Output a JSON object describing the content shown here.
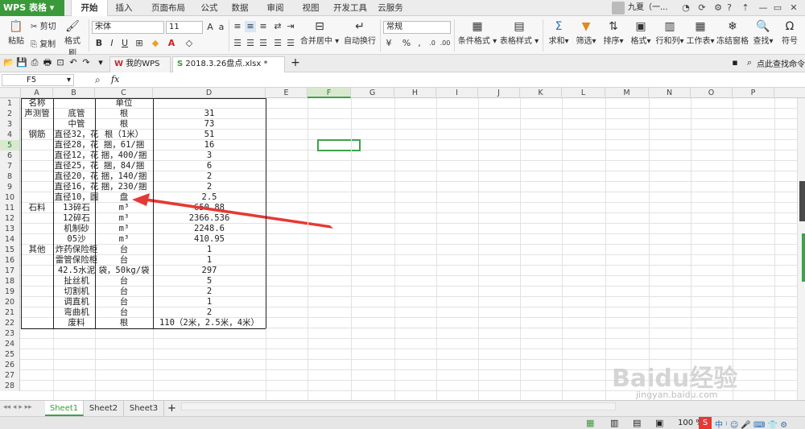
{
  "app": {
    "name": "WPS 表格",
    "accent": "#3a9a3a"
  },
  "menu": {
    "tabs": [
      "开始",
      "插入",
      "页面布局",
      "公式",
      "数据",
      "审阅",
      "视图",
      "开发工具",
      "云服务"
    ],
    "active": "开始",
    "user": "九夏（一..."
  },
  "ribbon": {
    "paste": "粘贴",
    "cut": "剪切",
    "copy": "复制",
    "format_painter": "格式刷",
    "font_name": "宋体",
    "font_size": "11",
    "merge_center": "合并居中",
    "wrap_text": "自动换行",
    "number_format": "常规",
    "cond_format": "条件格式",
    "table_style": "表格样式",
    "sum": "求和",
    "filter": "筛选",
    "sort": "排序",
    "format": "格式",
    "row_col": "行和列",
    "worksheet": "工作表",
    "freeze": "冻结窗格",
    "find": "查找",
    "symbol": "符号"
  },
  "tabs": {
    "home": "我的WPS",
    "file": "2018.3.26盘点.xlsx *",
    "search": "点此查找命令"
  },
  "formula_bar": {
    "cell_ref": "F5",
    "fx": "fx",
    "value": ""
  },
  "columns": [
    "A",
    "B",
    "C",
    "D",
    "E",
    "F",
    "G",
    "H",
    "I",
    "J",
    "K",
    "L",
    "M",
    "N",
    "O",
    "P"
  ],
  "selected_column": "F",
  "selected_row": "5",
  "rows": [
    {
      "n": "1",
      "a": "名称",
      "b": "",
      "c": "单位",
      "d": ""
    },
    {
      "n": "2",
      "a": "声测管",
      "b": "底管",
      "c": "根",
      "d": "31"
    },
    {
      "n": "3",
      "a": "",
      "b": "中管",
      "c": "根",
      "d": "73"
    },
    {
      "n": "4",
      "a": "钢筋",
      "b": "直径32，花",
      "c": "根（1米）",
      "d": "51"
    },
    {
      "n": "5",
      "a": "",
      "b": "直径28，花",
      "c": "捆，61/捆",
      "d": "16"
    },
    {
      "n": "6",
      "a": "",
      "b": "直径12，花",
      "c": "捆，400/捆",
      "d": "3"
    },
    {
      "n": "7",
      "a": "",
      "b": "直径25，花",
      "c": "捆，84/捆",
      "d": "6"
    },
    {
      "n": "8",
      "a": "",
      "b": "直径20，花",
      "c": "捆，140/捆",
      "d": "2"
    },
    {
      "n": "9",
      "a": "",
      "b": "直径16，花",
      "c": "捆，230/捆",
      "d": "2"
    },
    {
      "n": "10",
      "a": "",
      "b": "直径10，圆",
      "c": "盘",
      "d": "2.5"
    },
    {
      "n": "11",
      "a": "石料",
      "b": "13碎石",
      "c": "m³",
      "d": "650.88"
    },
    {
      "n": "12",
      "a": "",
      "b": "12碎石",
      "c": "m³",
      "d": "2366.536"
    },
    {
      "n": "13",
      "a": "",
      "b": "机制砂",
      "c": "m³",
      "d": "2248.6"
    },
    {
      "n": "14",
      "a": "",
      "b": "05沙",
      "c": "m³",
      "d": "410.95"
    },
    {
      "n": "15",
      "a": "其他",
      "b": "炸药保险柜",
      "c": "台",
      "d": "1"
    },
    {
      "n": "16",
      "a": "",
      "b": "雷管保险柜",
      "c": "台",
      "d": "1"
    },
    {
      "n": "17",
      "a": "",
      "b": "42.5水泥",
      "c": "袋，50kg/袋",
      "d": "297"
    },
    {
      "n": "18",
      "a": "",
      "b": "扯丝机",
      "c": "台",
      "d": "5"
    },
    {
      "n": "19",
      "a": "",
      "b": "切割机",
      "c": "台",
      "d": "2"
    },
    {
      "n": "20",
      "a": "",
      "b": "调直机",
      "c": "台",
      "d": "1"
    },
    {
      "n": "21",
      "a": "",
      "b": "弯曲机",
      "c": "台",
      "d": "2"
    },
    {
      "n": "22",
      "a": "",
      "b": "废料",
      "c": "根",
      "d": "110（2米，2.5米，4米）"
    },
    {
      "n": "23",
      "a": "",
      "b": "",
      "c": "",
      "d": ""
    },
    {
      "n": "24",
      "a": "",
      "b": "",
      "c": "",
      "d": ""
    },
    {
      "n": "25",
      "a": "",
      "b": "",
      "c": "",
      "d": ""
    },
    {
      "n": "26",
      "a": "",
      "b": "",
      "c": "",
      "d": ""
    },
    {
      "n": "27",
      "a": "",
      "b": "",
      "c": "",
      "d": ""
    },
    {
      "n": "28",
      "a": "",
      "b": "",
      "c": "",
      "d": ""
    }
  ],
  "sheets": [
    "Sheet1",
    "Sheet2",
    "Sheet3"
  ],
  "active_sheet": "Sheet1",
  "status": {
    "zoom": "100 %"
  },
  "annotation": {
    "color": "#e53935"
  },
  "watermark": {
    "text": "Baidu经验",
    "url": "jingyan.baidu.com"
  }
}
